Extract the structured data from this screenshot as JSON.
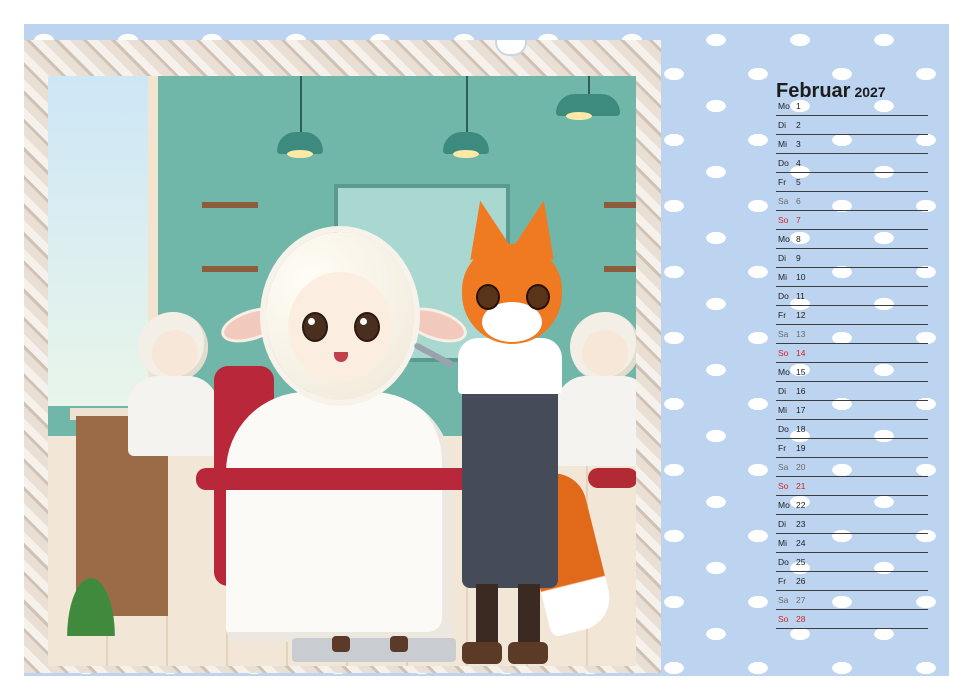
{
  "calendar": {
    "month": "Februar",
    "year": "2027",
    "days": [
      {
        "wd": "Mo",
        "d": "1",
        "kind": "weekday"
      },
      {
        "wd": "Di",
        "d": "2",
        "kind": "weekday"
      },
      {
        "wd": "Mi",
        "d": "3",
        "kind": "weekday"
      },
      {
        "wd": "Do",
        "d": "4",
        "kind": "weekday"
      },
      {
        "wd": "Fr",
        "d": "5",
        "kind": "weekday"
      },
      {
        "wd": "Sa",
        "d": "6",
        "kind": "saturday"
      },
      {
        "wd": "So",
        "d": "7",
        "kind": "sunday"
      },
      {
        "wd": "Mo",
        "d": "8",
        "kind": "weekday"
      },
      {
        "wd": "Di",
        "d": "9",
        "kind": "weekday"
      },
      {
        "wd": "Mi",
        "d": "10",
        "kind": "weekday"
      },
      {
        "wd": "Do",
        "d": "11",
        "kind": "weekday"
      },
      {
        "wd": "Fr",
        "d": "12",
        "kind": "weekday"
      },
      {
        "wd": "Sa",
        "d": "13",
        "kind": "saturday"
      },
      {
        "wd": "So",
        "d": "14",
        "kind": "sunday"
      },
      {
        "wd": "Mo",
        "d": "15",
        "kind": "weekday"
      },
      {
        "wd": "Di",
        "d": "16",
        "kind": "weekday"
      },
      {
        "wd": "Mi",
        "d": "17",
        "kind": "weekday"
      },
      {
        "wd": "Do",
        "d": "18",
        "kind": "weekday"
      },
      {
        "wd": "Fr",
        "d": "19",
        "kind": "weekday"
      },
      {
        "wd": "Sa",
        "d": "20",
        "kind": "saturday"
      },
      {
        "wd": "So",
        "d": "21",
        "kind": "sunday"
      },
      {
        "wd": "Mo",
        "d": "22",
        "kind": "weekday"
      },
      {
        "wd": "Di",
        "d": "23",
        "kind": "weekday"
      },
      {
        "wd": "Mi",
        "d": "24",
        "kind": "weekday"
      },
      {
        "wd": "Do",
        "d": "25",
        "kind": "weekday"
      },
      {
        "wd": "Fr",
        "d": "26",
        "kind": "weekday"
      },
      {
        "wd": "Sa",
        "d": "27",
        "kind": "saturday"
      },
      {
        "wd": "So",
        "d": "28",
        "kind": "sunday"
      }
    ]
  },
  "colors": {
    "background": "#bcd4f0",
    "sunday": "#d12424",
    "saturday": "#6a6a6a",
    "rule_line": "#3d3d3d"
  }
}
